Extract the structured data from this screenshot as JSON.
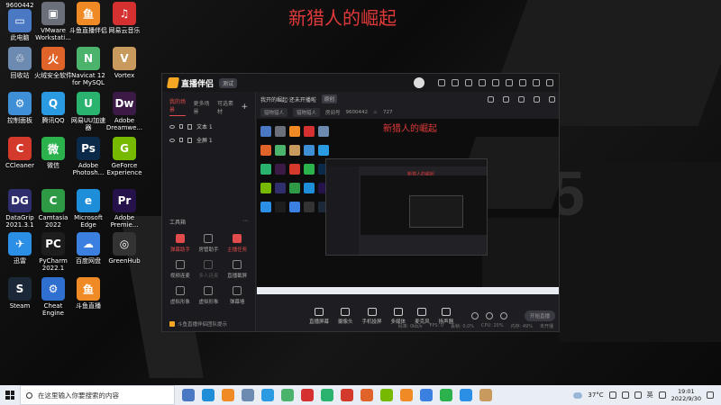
{
  "desktop": {
    "overlay_title": "新猎人的崛起",
    "icons": [
      {
        "label": "此电脑",
        "overlay": "9600442",
        "color": "#4a78c2",
        "glyph": "▭",
        "icon": "computer-icon"
      },
      {
        "label": "VMware Workstati...",
        "color": "#6a6f7a",
        "glyph": "▣",
        "icon": "vmware-icon"
      },
      {
        "label": "斗鱼直播伴侣",
        "color": "#f08a24",
        "glyph": "鱼",
        "icon": "douyu-icon"
      },
      {
        "label": "网易云音乐",
        "color": "#d63131",
        "glyph": "♫",
        "icon": "netease-music-icon"
      },
      {
        "label": "回收站",
        "color": "#6d8ab0",
        "glyph": "♲",
        "icon": "recycle-bin-icon"
      },
      {
        "label": "火绒安全软件",
        "color": "#e0632a",
        "glyph": "火",
        "icon": "huorong-icon"
      },
      {
        "label": "Navicat 12 for MySQL",
        "color": "#4bb36b",
        "glyph": "N",
        "icon": "navicat-icon"
      },
      {
        "label": "Vortex",
        "color": "#c89a5e",
        "glyph": "V",
        "icon": "vortex-icon"
      },
      {
        "label": "控制面板",
        "color": "#3f8fd6",
        "glyph": "⚙",
        "icon": "control-panel-icon"
      },
      {
        "label": "腾讯QQ",
        "color": "#2a9be3",
        "glyph": "Q",
        "icon": "qq-icon"
      },
      {
        "label": "网易UU加速器",
        "color": "#29b36f",
        "glyph": "U",
        "icon": "uu-icon"
      },
      {
        "label": "Adobe Dreamwe...",
        "color": "#3c1a46",
        "glyph": "Dw",
        "icon": "dreamweaver-icon"
      },
      {
        "label": "CCleaner",
        "color": "#d33a2c",
        "glyph": "C",
        "icon": "ccleaner-icon"
      },
      {
        "label": "微信",
        "color": "#2bb24c",
        "glyph": "微",
        "icon": "wechat-icon"
      },
      {
        "label": "Adobe Photosh...",
        "color": "#0b2a4a",
        "glyph": "Ps",
        "icon": "photoshop-icon"
      },
      {
        "label": "GeForce Experience",
        "color": "#76b900",
        "glyph": "G",
        "icon": "geforce-icon"
      },
      {
        "label": "DataGrip 2021.3.1",
        "color": "#2f2f6e",
        "glyph": "DG",
        "icon": "datagrip-icon"
      },
      {
        "label": "Camtasia 2022",
        "color": "#2e9a46",
        "glyph": "C",
        "icon": "camtasia-icon"
      },
      {
        "label": "Microsoft Edge",
        "color": "#1e8ed8",
        "glyph": "e",
        "icon": "edge-icon"
      },
      {
        "label": "Adobe Premie...",
        "color": "#25124a",
        "glyph": "Pr",
        "icon": "premiere-icon"
      },
      {
        "label": "迅雷",
        "color": "#2b8fe6",
        "glyph": "✈",
        "icon": "xunlei-icon"
      },
      {
        "label": "PyCharm 2022.1",
        "color": "#1d1d1d",
        "glyph": "PC",
        "icon": "pycharm-icon"
      },
      {
        "label": "百度网盘",
        "color": "#3b7fe0",
        "glyph": "☁",
        "icon": "baidu-netdisk-icon"
      },
      {
        "label": "GreenHub",
        "color": "#333333",
        "glyph": "◎",
        "icon": "greenhub-icon"
      },
      {
        "label": "Steam",
        "color": "#1b2838",
        "glyph": "S",
        "icon": "steam-icon"
      },
      {
        "label": "Cheat Engine",
        "color": "#2f6fd0",
        "glyph": "⚙",
        "icon": "cheat-engine-icon"
      },
      {
        "label": "斗鱼直播",
        "color": "#f08a24",
        "glyph": "鱼",
        "icon": "douyu-live-icon"
      }
    ]
  },
  "app": {
    "name": "直播伴侣",
    "version_badge": "测试",
    "left_tabs": [
      "我的场景",
      "更多场景",
      "可选素材"
    ],
    "scenes": [
      {
        "label": "文本 1"
      },
      {
        "label": "全屏 1"
      }
    ],
    "tools_label": "工具箱",
    "tools": [
      {
        "label": "弹幕助手",
        "state": "red"
      },
      {
        "label": "房管助手",
        "state": "normal"
      },
      {
        "label": "主播任务",
        "state": "red"
      },
      {
        "label": "视频连麦",
        "state": "normal"
      },
      {
        "label": "多人连麦",
        "state": "disabled"
      },
      {
        "label": "直播截屏",
        "state": "normal"
      },
      {
        "label": "虚拟形象",
        "state": "normal"
      },
      {
        "label": "虚拟形象",
        "state": "normal"
      },
      {
        "label": "弹幕墙",
        "state": "normal"
      }
    ],
    "footer": "斗鱼直播伴侣团队提示",
    "room": {
      "title": "我开的崛起·还未开播啦",
      "tag": "原创",
      "category_a": "猎物猎人",
      "category_b": "猎物猎人",
      "room_id_label": "房间号",
      "room_id": "9600442",
      "heat": "727"
    },
    "preview_title": "新猎人的崛起",
    "controls": [
      "直播屏幕",
      "摄像头",
      "手机投屏",
      "多媒体",
      "麦克风",
      "扬声器"
    ],
    "live_button": "开始直播",
    "status": [
      "码率: 0kb/s",
      "FPS: 0",
      "丢帧: 0.0%",
      "CPU: 20%",
      "内存: 49%",
      "未开播"
    ]
  },
  "taskbar": {
    "search_placeholder": "在这里输入你要搜索的内容",
    "weather": "37°C",
    "ime": "英",
    "time": "19:01",
    "date": "2022/9/30"
  }
}
